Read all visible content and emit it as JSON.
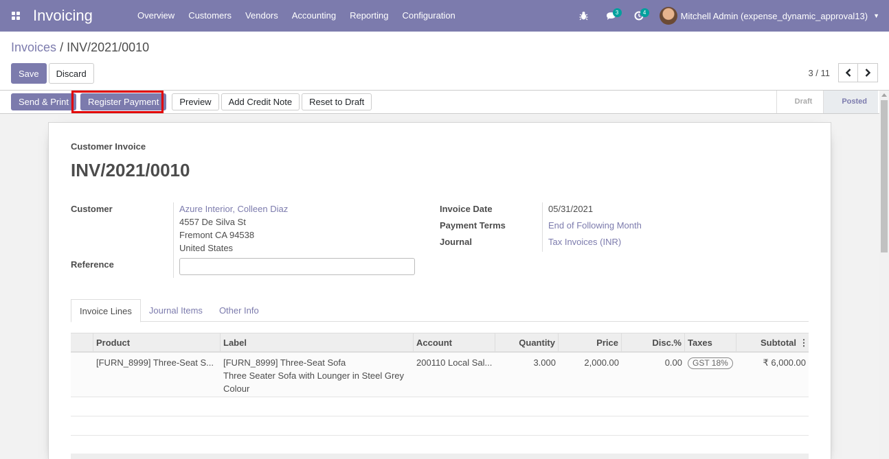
{
  "navbar": {
    "app_name": "Invoicing",
    "menu": [
      "Overview",
      "Customers",
      "Vendors",
      "Accounting",
      "Reporting",
      "Configuration"
    ],
    "messages_count": "3",
    "activities_count": "4",
    "user_name": "Mitchell Admin (expense_dynamic_approval13)"
  },
  "breadcrumb": {
    "parent": "Invoices",
    "separator": "/",
    "current": "INV/2021/0010"
  },
  "actions": {
    "save": "Save",
    "discard": "Discard"
  },
  "pager": {
    "value": "3 / 11"
  },
  "statusbar": {
    "buttons": [
      "Send & Print",
      "Register Payment",
      "Preview",
      "Add Credit Note",
      "Reset to Draft"
    ],
    "stages": [
      "Draft",
      "Posted"
    ],
    "active_stage": "Posted"
  },
  "form": {
    "doc_type": "Customer Invoice",
    "doc_name": "INV/2021/0010",
    "customer_label": "Customer",
    "customer_name": "Azure Interior, Colleen Diaz",
    "address_line1": "4557 De Silva St",
    "address_line2": "Fremont CA 94538",
    "address_line3": "United States",
    "reference_label": "Reference",
    "reference_value": "",
    "invoice_date_label": "Invoice Date",
    "invoice_date": "05/31/2021",
    "payment_terms_label": "Payment Terms",
    "payment_terms": "End of Following Month",
    "journal_label": "Journal",
    "journal": "Tax Invoices (INR)"
  },
  "tabs": [
    "Invoice Lines",
    "Journal Items",
    "Other Info"
  ],
  "table": {
    "columns": [
      "Product",
      "Label",
      "Account",
      "Quantity",
      "Price",
      "Disc.%",
      "Taxes",
      "Subtotal"
    ],
    "rows": [
      {
        "product": "[FURN_8999] Three-Seat S...",
        "label_line1": "[FURN_8999] Three-Seat Sofa",
        "label_line2": "Three Seater Sofa with Lounger in Steel Grey Colour",
        "account": "200110 Local Sal...",
        "quantity": "3.000",
        "price": "2,000.00",
        "discount": "0.00",
        "tax": "GST 18%",
        "subtotal": "₹ 6,000.00"
      }
    ]
  },
  "colors": {
    "brand": "#7c7bad",
    "highlight": "#e20000",
    "badge": "#00a09d"
  }
}
